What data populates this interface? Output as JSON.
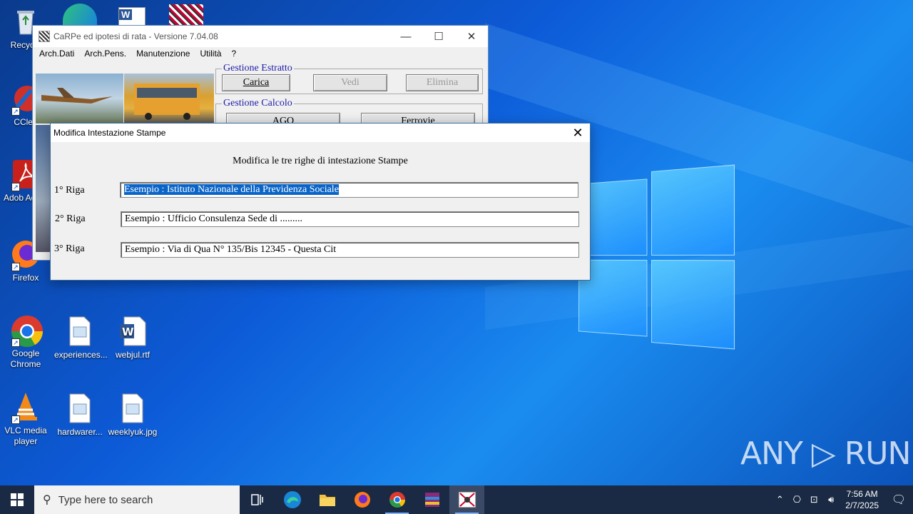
{
  "desktop": {
    "icons": [
      {
        "label": "Recycle"
      },
      {
        "label": "CClea"
      },
      {
        "label": "Adob Acrob"
      },
      {
        "label": "Firefox"
      },
      {
        "label": "Google Chrome"
      },
      {
        "label": "experiences..."
      },
      {
        "label": "webjul.rtf"
      },
      {
        "label": "VLC media player"
      },
      {
        "label": "hardwarer..."
      },
      {
        "label": "weeklyuk.jpg"
      }
    ],
    "watermark": "ANY ▷ RUN"
  },
  "app_window": {
    "title": "CaRPe ed ipotesi di rata  -  Versione 7.04.08",
    "controls": {
      "minimize": "—",
      "maximize": "☐",
      "close": "✕"
    },
    "menu": [
      "Arch.Dati",
      "Arch.Pens.",
      "Manutenzione",
      "Utilità",
      "?"
    ],
    "gestione_estratto": {
      "legend": "Gestione Estratto",
      "buttons": [
        "Carica",
        "Vedi",
        "Elimina"
      ]
    },
    "gestione_calcolo": {
      "legend": "Gestione Calcolo",
      "buttons": [
        "AGO",
        "Ferrovie"
      ]
    }
  },
  "dialog": {
    "title": "Modifica Intestazione Stampe",
    "close": "✕",
    "instruction": "Modifica le tre righe di intestazione Stampe",
    "rows": [
      {
        "label": "1° Riga",
        "value": "Esempio : Istituto Nazionale della Previdenza Sociale"
      },
      {
        "label": "2° Riga",
        "value": "Esempio : Ufficio Consulenza Sede di ........."
      },
      {
        "label": "3° Riga",
        "value": "Esempio : Via di Qua N° 135/Bis    12345 - Questa Cit"
      }
    ]
  },
  "taskbar": {
    "search_placeholder": "Type here to search",
    "time": "7:56 AM",
    "date": "2/7/2025",
    "tray_icons": [
      "chevron-up",
      "meet-now",
      "network",
      "volume"
    ]
  }
}
